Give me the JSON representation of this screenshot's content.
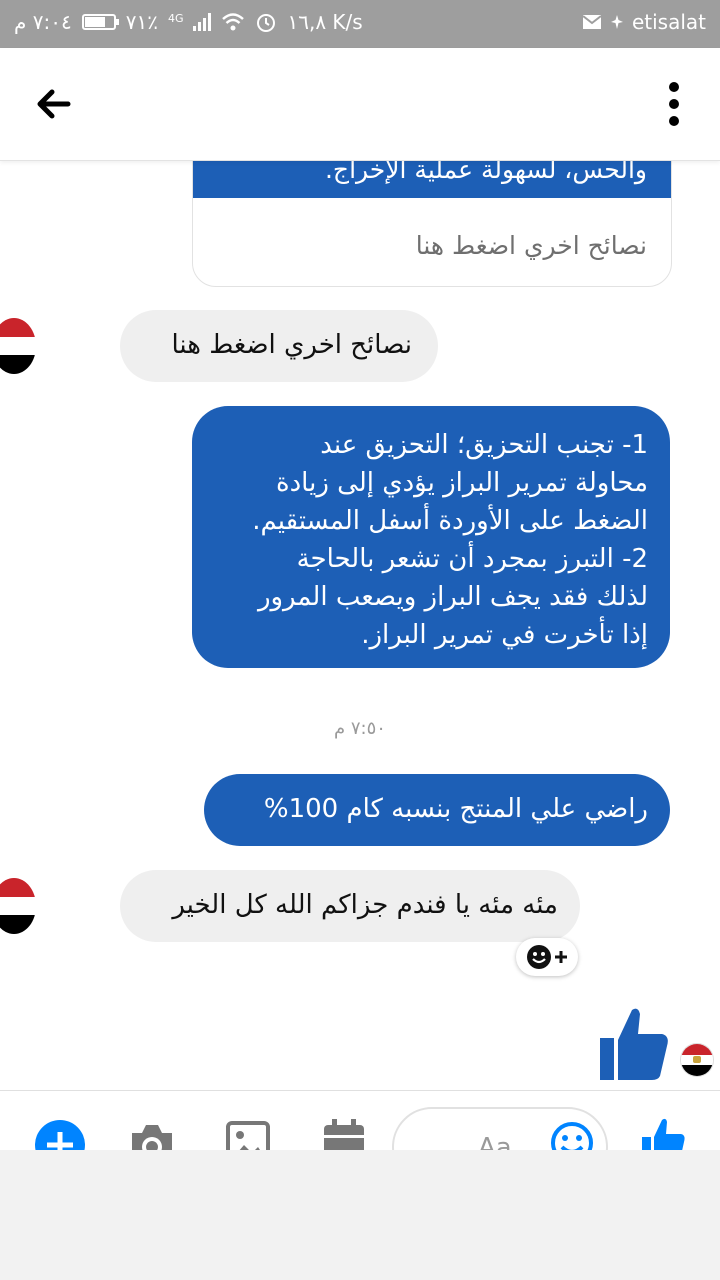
{
  "status_bar": {
    "time": "٧:٠٤ م",
    "battery": "٧١٪",
    "battery_level": 0.71,
    "network": "4G",
    "speed": "١٦,٨ K/s",
    "carrier": "etisalat"
  },
  "header": {
    "back_icon": "arrow-left-icon",
    "menu_icon": "more-vertical-icon"
  },
  "messages": {
    "card_top_text": "والحس، لسهولة عملية الإخراج.",
    "card_link_text": "نصائح اخري اضغط هنا",
    "in_1": "نصائح اخري اضغط هنا",
    "out_1_lines": [
      "1- تجنب التحزيق؛ التحزيق عند",
      "محاولة تمرير البراز يؤدي إلى زيادة",
      "الضغط على الأوردة أسفل المستقيم.",
      "2- التبرز بمجرد أن تشعر بالحاجة",
      "لذلك فقد يجف البراز ويصعب المرور",
      "إذا تأخرت في تمرير البراز."
    ],
    "timestamp": "٧:٥٠ م",
    "out_2": "راضي علي المنتج بنسبه كام 100%",
    "in_2": "مئه مئه يا فندم جزاكم الله كل الخير"
  },
  "composer": {
    "placeholder": "Aa",
    "icons": [
      "plus-icon",
      "camera-icon",
      "image-icon",
      "calendar-icon",
      "emoji-icon",
      "like-icon"
    ]
  },
  "colors": {
    "accent": "#1d5fb6",
    "messenger_blue": "#0084ff",
    "incoming_bubble": "#efefef"
  }
}
